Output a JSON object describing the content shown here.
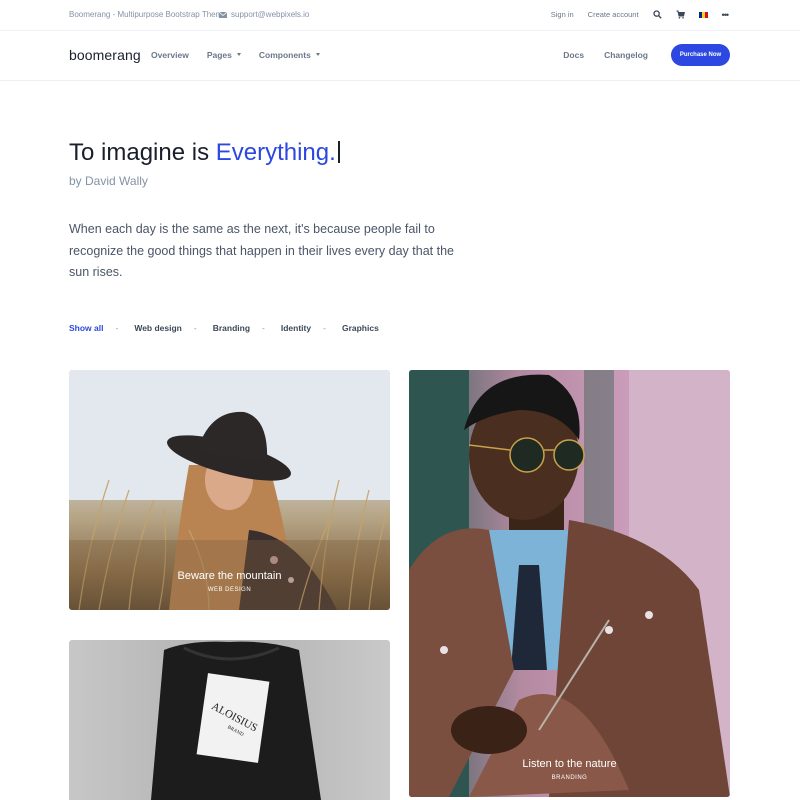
{
  "topbar": {
    "brand_line": "Boomerang - Multipurpose Bootstrap Theme",
    "support_email": "support@webpixels.io",
    "sign_in": "Sign in",
    "create_account": "Create account",
    "more": "•••"
  },
  "nav": {
    "logo_text": "boomerang",
    "items": [
      "Overview",
      "Pages",
      "Components"
    ],
    "right_items": [
      "Docs",
      "Changelog"
    ],
    "purchase_label": "Purchase Now"
  },
  "hero": {
    "title_plain": "To imagine is ",
    "title_accent": "Everything.",
    "byline": "by David Wally",
    "quote": "When each day is the same as the next, it's because people fail to recognize the good things that happen in their lives every day that the sun rises."
  },
  "filters": {
    "items": [
      "Show all",
      "Web design",
      "Branding",
      "Identity",
      "Graphics"
    ],
    "separator": "-"
  },
  "cards": [
    {
      "title": "Beware the mountain",
      "subtitle": "WEB DESIGN"
    },
    {
      "title": "Listen to the nature",
      "subtitle": "BRANDING"
    },
    {
      "image_text": "ALOISIUS BRAND"
    }
  ],
  "colors": {
    "accent": "#2c48e0",
    "text_dark": "#1a1f2c",
    "text_muted": "#8492a6"
  },
  "icons": [
    "mail-icon",
    "search-icon",
    "cart-icon",
    "flag-icon",
    "more-icon",
    "chevron-down-icon"
  ]
}
